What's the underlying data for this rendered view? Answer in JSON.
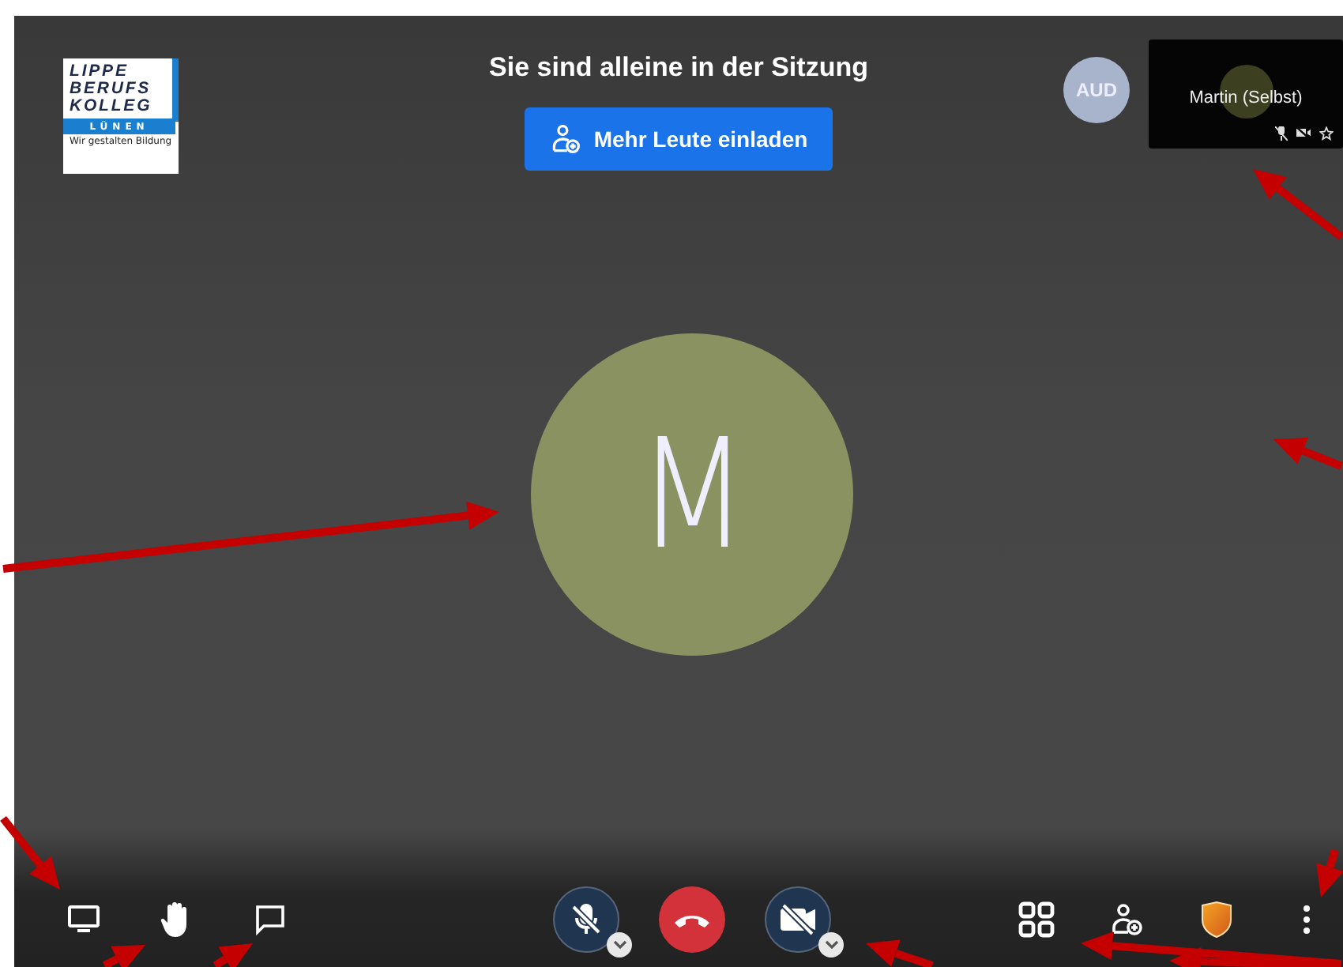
{
  "logo": {
    "lines": [
      "LIPPE",
      "BERUFS",
      "KOLLEG"
    ],
    "place": "LÜNEN",
    "slogan": "Wir gestalten Bildung"
  },
  "title": "Sie sind alleine in der Sitzung",
  "invite_button": {
    "label": "Mehr Leute einladen"
  },
  "participant": {
    "initials": "AUD"
  },
  "self_view": {
    "name": "Martin (Selbst)",
    "mic_muted": true,
    "camera_off": true
  },
  "main_avatar": {
    "initial": "M"
  },
  "toolbar": {
    "left": [
      {
        "kind": "screen_share"
      },
      {
        "kind": "raise_hand"
      },
      {
        "kind": "chat"
      }
    ],
    "center": [
      {
        "kind": "microphone",
        "muted": true
      },
      {
        "kind": "hangup"
      },
      {
        "kind": "camera",
        "muted": true
      }
    ],
    "right": [
      {
        "kind": "tile_view"
      },
      {
        "kind": "invite"
      },
      {
        "kind": "security"
      },
      {
        "kind": "more"
      }
    ]
  }
}
